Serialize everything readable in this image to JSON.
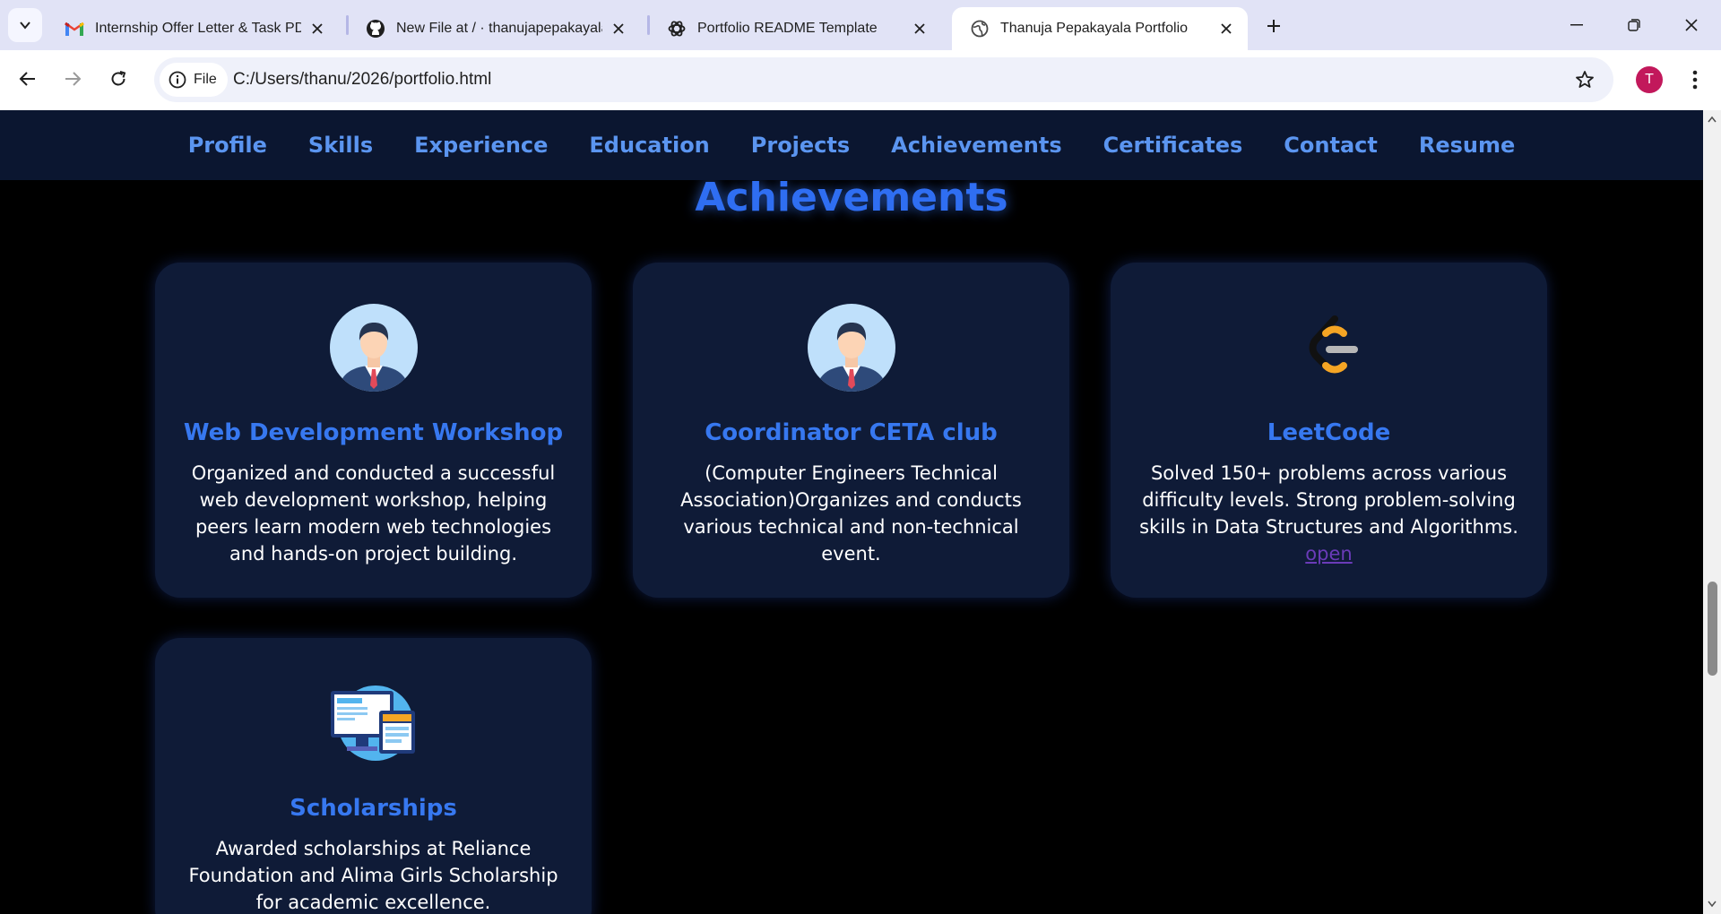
{
  "browser": {
    "tabs": [
      {
        "title": "Internship Offer Letter & Task PDF",
        "icon": "gmail-icon"
      },
      {
        "title": "New File at / · thanujapepakayala/p",
        "icon": "github-icon"
      },
      {
        "title": "Portfolio README Template",
        "icon": "chatgpt-icon"
      },
      {
        "title": "Thanuja Pepakayala Portfolio",
        "icon": "globe-icon",
        "active": true
      }
    ],
    "security_chip": "File",
    "url": "C:/Users/thanu/2026/portfolio.html",
    "profile_initial": "T",
    "profile_color": "#c2185b"
  },
  "site": {
    "nav": [
      "Profile",
      "Skills",
      "Experience",
      "Education",
      "Projects",
      "Achievements",
      "Certificates",
      "Contact",
      "Resume"
    ],
    "section_title": "Achievements",
    "cards": [
      {
        "title": "Web Development Workshop",
        "text": "Organized and conducted a successful web development workshop, helping peers learn modern web technologies and hands-on project building.",
        "icon": "businessman-avatar-icon"
      },
      {
        "title": "Coordinator CETA club",
        "text": "(Computer Engineers Technical Association)Organizes and conducts various technical and non-technical event.",
        "icon": "businessman-avatar-icon"
      },
      {
        "title": "LeetCode",
        "text": "Solved 150+ problems across various difficulty levels. Strong problem-solving skills in Data Structures and Algorithms.",
        "link": "open",
        "icon": "leetcode-logo-icon"
      },
      {
        "title": "Scholarships",
        "text": "Awarded scholarships at Reliance Foundation and Alima Girls Scholarship for academic excellence.",
        "icon": "computer-screens-icon"
      }
    ]
  },
  "colors": {
    "accent": "#2f6ef2",
    "card_bg": "#0f1b37",
    "nav_bg": "#0b1630"
  }
}
